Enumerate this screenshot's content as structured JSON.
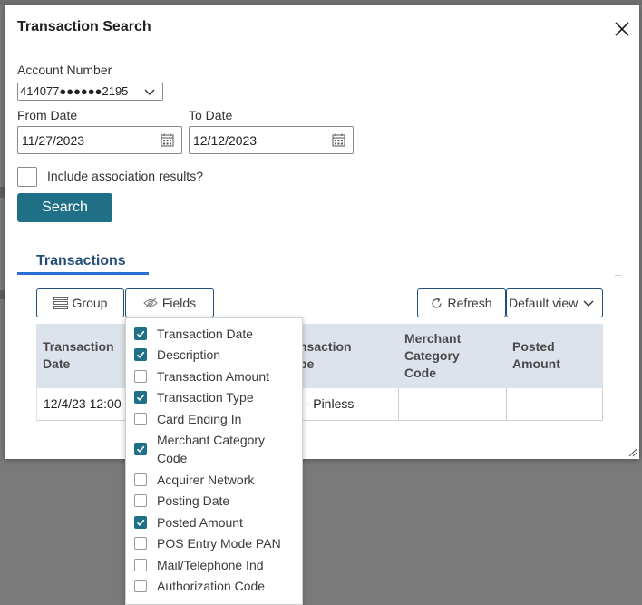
{
  "modal": {
    "title": "Transaction Search"
  },
  "form": {
    "account_label": "Account Number",
    "account_value": "414077●●●●●●2195",
    "from_label": "From Date",
    "from_value": "11/27/2023",
    "to_label": "To Date",
    "to_value": "12/12/2023",
    "assoc_label": "Include association results?",
    "assoc_checked": false,
    "search_label": "Search"
  },
  "tabs": {
    "active": "Transactions"
  },
  "toolbar": {
    "group_label": "Group",
    "fields_label": "Fields",
    "refresh_label": "Refresh",
    "view_label": "Default view"
  },
  "table": {
    "headers": {
      "date": "Transaction\nDate",
      "type": "nsaction\npe",
      "mcc": "Merchant\nCategory\nCode",
      "posted": "Posted\nAmount"
    },
    "row": {
      "date": "12/4/23 12:00",
      "type": "d - Pinless",
      "mcc": "",
      "posted": ""
    }
  },
  "fields_menu": [
    {
      "label": "Transaction Date",
      "checked": true
    },
    {
      "label": "Description",
      "checked": true
    },
    {
      "label": "Transaction Amount",
      "checked": false
    },
    {
      "label": "Transaction Type",
      "checked": true
    },
    {
      "label": "Card Ending In",
      "checked": false
    },
    {
      "label": "Merchant Category Code",
      "checked": true
    },
    {
      "label": "Acquirer Network",
      "checked": false
    },
    {
      "label": "Posting Date",
      "checked": false
    },
    {
      "label": "Posted Amount",
      "checked": true
    },
    {
      "label": "POS Entry Mode PAN",
      "checked": false
    },
    {
      "label": "Mail/Telephone Ind",
      "checked": false
    },
    {
      "label": "Authorization Code",
      "checked": false
    }
  ],
  "colors": {
    "accent": "#1f6f86",
    "tab_underline": "#2a6fd6",
    "backdrop": "#7a7a7a"
  }
}
